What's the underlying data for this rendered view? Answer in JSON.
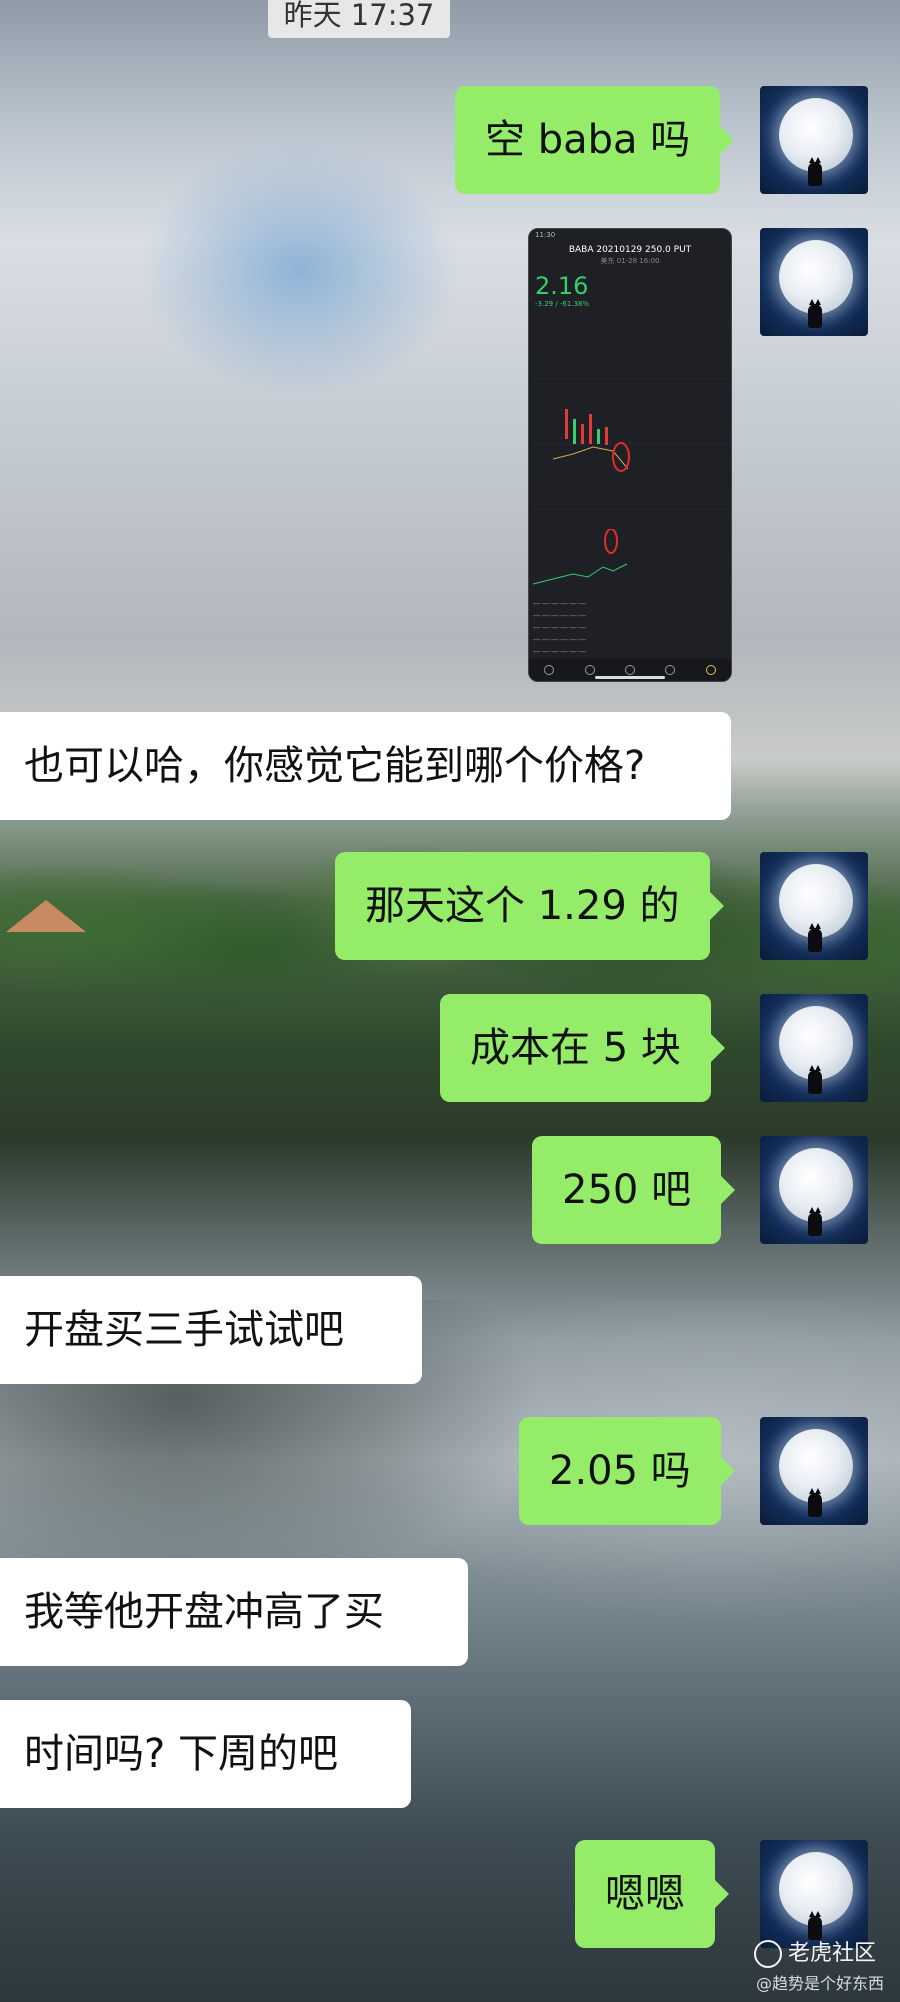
{
  "chat": {
    "timestamp": "昨天 17:37",
    "messages": [
      {
        "side": "me",
        "type": "text",
        "text": "空 baba 吗"
      },
      {
        "side": "me",
        "type": "image",
        "description": "option quote screenshot"
      },
      {
        "side": "other",
        "type": "text",
        "text": "也可以哈，你感觉它能到哪个价格?"
      },
      {
        "side": "me",
        "type": "text",
        "text": "那天这个 1.29 的"
      },
      {
        "side": "me",
        "type": "text",
        "text": "成本在 5 块"
      },
      {
        "side": "me",
        "type": "text",
        "text": "250 吧"
      },
      {
        "side": "other",
        "type": "text",
        "text": "开盘买三手试试吧"
      },
      {
        "side": "me",
        "type": "text",
        "text": "2.05 吗"
      },
      {
        "side": "other",
        "type": "text",
        "text": "我等他开盘冲高了买"
      },
      {
        "side": "other",
        "type": "text",
        "text": "时间吗? 下周的吧"
      },
      {
        "side": "me",
        "type": "text",
        "text": "嗯嗯"
      }
    ]
  },
  "shared_image": {
    "status_time": "11:30",
    "title": "BABA 20210129 250.0 PUT",
    "subtitle": "美东 01-28 16:00",
    "price": "2.16",
    "change": "-3.29 / -61.38%"
  },
  "watermark": {
    "brand": "老虎社区",
    "handle": "@趋势是个好东西"
  },
  "colors": {
    "my_bubble": "#95ec69",
    "other_bubble": "#ffffff",
    "price_green": "#35d06a"
  }
}
